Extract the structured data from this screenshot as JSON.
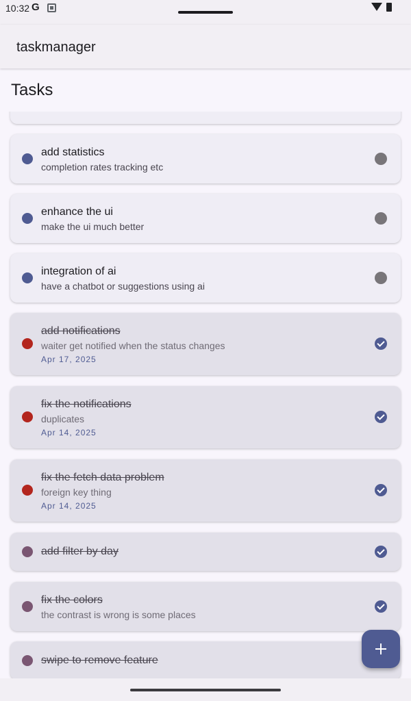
{
  "status_bar": {
    "time": "10:32",
    "g_label": "G"
  },
  "app_bar": {
    "title": "taskmanager"
  },
  "page": {
    "title": "Tasks"
  },
  "colors": {
    "accent": "#4f5b92",
    "priority_high": "#b3261e",
    "priority_low": "#7a5672"
  },
  "tasks": [
    {
      "title": "",
      "description": "",
      "date": "",
      "done": false,
      "priority_color": "#4f5b92"
    },
    {
      "title": "add statistics",
      "description": "completion rates tracking etc",
      "date": "",
      "done": false,
      "priority_color": "#4f5b92"
    },
    {
      "title": "enhance the ui",
      "description": "make the ui much better",
      "date": "",
      "done": false,
      "priority_color": "#4f5b92"
    },
    {
      "title": "integration of ai",
      "description": "have a chatbot or suggestions using ai",
      "date": "",
      "done": false,
      "priority_color": "#4f5b92"
    },
    {
      "title": "add notifications",
      "description": "waiter get notified when the status changes",
      "date": "Apr 17, 2025",
      "done": true,
      "priority_color": "#b3261e"
    },
    {
      "title": "fix the notifications",
      "description": "duplicates",
      "date": "Apr 14, 2025",
      "done": true,
      "priority_color": "#b3261e"
    },
    {
      "title": "fix the fetch data problem",
      "description": "foreign key thing",
      "date": "Apr 14, 2025",
      "done": true,
      "priority_color": "#b3261e"
    },
    {
      "title": "add filter by day",
      "description": "",
      "date": "",
      "done": true,
      "priority_color": "#7a5672"
    },
    {
      "title": "fix the colors",
      "description": "the contrast is wrong is some places",
      "date": "",
      "done": true,
      "priority_color": "#7a5672"
    },
    {
      "title": "swipe to remove feature",
      "description": "",
      "date": "",
      "done": true,
      "priority_color": "#7a5672"
    }
  ],
  "fab": {
    "icon": "plus-icon"
  }
}
